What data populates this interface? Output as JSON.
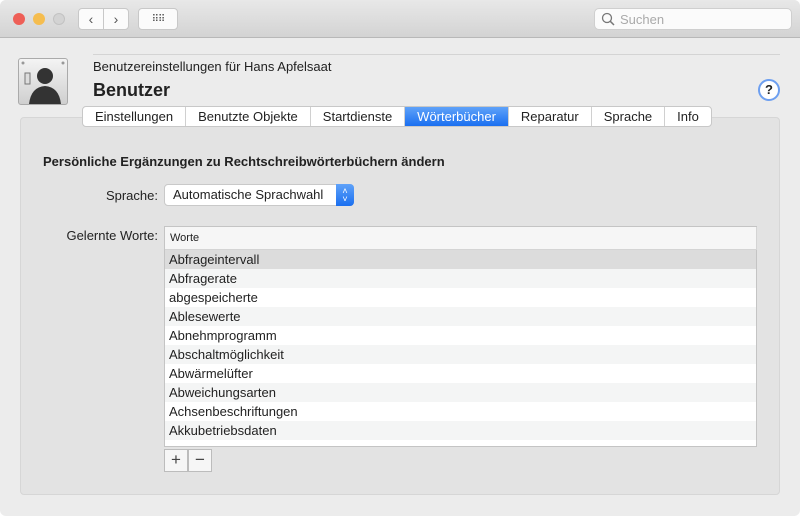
{
  "toolbar": {
    "back_icon": "chevron-left",
    "forward_icon": "chevron-right",
    "grid_icon": "grid",
    "search_placeholder": "Suchen"
  },
  "header": {
    "subtitle": "Benutzereinstellungen für Hans Apfelsaat",
    "title": "Benutzer",
    "help": "?"
  },
  "tabs": [
    {
      "label": "Einstellungen"
    },
    {
      "label": "Benutzte Objekte"
    },
    {
      "label": "Startdienste"
    },
    {
      "label": "Wörterbücher",
      "active": true
    },
    {
      "label": "Reparatur"
    },
    {
      "label": "Sprache"
    },
    {
      "label": "Info"
    }
  ],
  "main": {
    "heading": "Persönliche Ergänzungen zu Rechtschreibwörterbüchern ändern",
    "language_label": "Sprache:",
    "language_value": "Automatische Sprachwahl",
    "words_label": "Gelernte Worte:",
    "column_header": "Worte",
    "words": [
      "Abfrageintervall",
      "Abfragerate",
      "abgespeicherte",
      "Ablesewerte",
      "Abnehmprogramm",
      "Abschaltmöglichkeit",
      "Abwärmelüfter",
      "Abweichungsarten",
      "Achsenbeschriftungen",
      "Akkubetriebsdaten"
    ],
    "add_label": "+",
    "remove_label": "−"
  },
  "colors": {
    "accent": "#1a6ff0",
    "close": "#ee5f57",
    "minimize": "#f5bd4f",
    "zoom_disabled": "#d0d0d0"
  }
}
